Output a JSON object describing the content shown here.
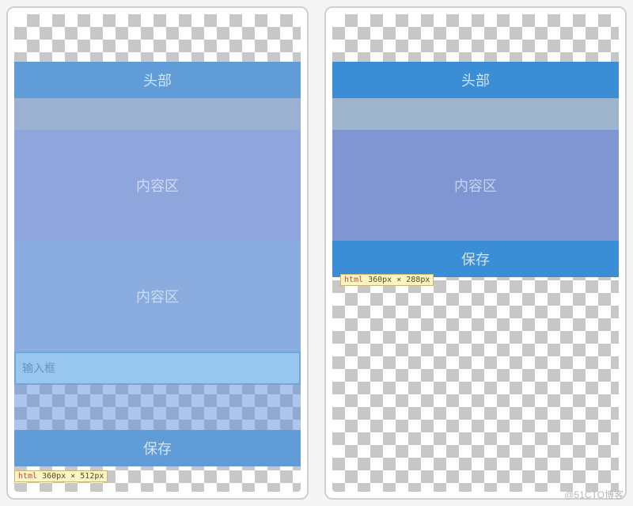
{
  "left": {
    "header": "头部",
    "content1": "内容区",
    "content2": "内容区",
    "input_placeholder": "输入框",
    "save": "保存",
    "dim_label": "html",
    "dim_value": "360px × 512px"
  },
  "right": {
    "header": "头部",
    "content": "内容区",
    "save": "保存",
    "dim_label": "html",
    "dim_value": "360px × 288px"
  },
  "watermark": "@51CTO博客"
}
